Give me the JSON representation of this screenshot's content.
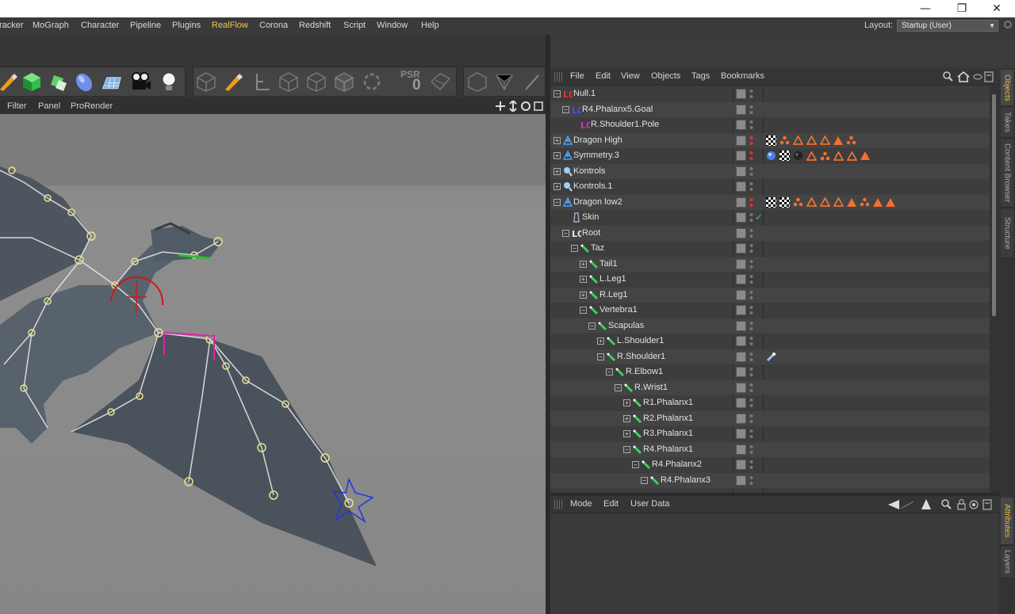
{
  "window": {
    "minimize": "—",
    "restore": "❐",
    "close": "✕"
  },
  "menubar": {
    "items": [
      "racker",
      "MoGraph",
      "Character",
      "Pipeline",
      "Plugins",
      "RealFlow",
      "Corona",
      "Redshift",
      "Script",
      "Window",
      "Help"
    ],
    "active": "RealFlow",
    "layout_label": "Layout:",
    "layout_value": "Startup (User)"
  },
  "toolbar": {
    "psr_label": "PSR",
    "psr_value": "0"
  },
  "viewport": {
    "menu": [
      "Filter",
      "Panel",
      "ProRender"
    ]
  },
  "object_manager": {
    "menu": [
      "File",
      "Edit",
      "View",
      "Objects",
      "Tags",
      "Bookmarks"
    ],
    "objects": [
      {
        "name": "Null.1",
        "indent": 0,
        "type": "null",
        "expand": "minus"
      },
      {
        "name": "R4.Phalanx5.Goal",
        "indent": 1,
        "type": "goal",
        "expand": "minus"
      },
      {
        "name": "R.Shoulder1.Pole",
        "indent": 2,
        "type": "pole",
        "expand": "none"
      },
      {
        "name": "Dragon High",
        "indent": 0,
        "type": "mesh",
        "expand": "plus"
      },
      {
        "name": "Symmetry.3",
        "indent": 0,
        "type": "mesh",
        "expand": "plus"
      },
      {
        "name": "Kontrols",
        "indent": 0,
        "type": "ctrl",
        "expand": "plus"
      },
      {
        "name": "Kontrols.1",
        "indent": 0,
        "type": "ctrl",
        "expand": "plus"
      },
      {
        "name": "Dragon low2",
        "indent": 0,
        "type": "mesh",
        "expand": "minus"
      },
      {
        "name": "Skin",
        "indent": 1,
        "type": "skin",
        "expand": "none"
      },
      {
        "name": "Root",
        "indent": 1,
        "type": "root",
        "expand": "minus"
      },
      {
        "name": "Taz",
        "indent": 2,
        "type": "joint",
        "expand": "minus"
      },
      {
        "name": "Tail1",
        "indent": 3,
        "type": "joint",
        "expand": "plus"
      },
      {
        "name": "L.Leg1",
        "indent": 3,
        "type": "joint",
        "expand": "plus"
      },
      {
        "name": "R.Leg1",
        "indent": 3,
        "type": "joint",
        "expand": "plus"
      },
      {
        "name": "Vertebra1",
        "indent": 3,
        "type": "joint",
        "expand": "minus"
      },
      {
        "name": "Scapulas",
        "indent": 4,
        "type": "joint",
        "expand": "minus"
      },
      {
        "name": "L.Shoulder1",
        "indent": 5,
        "type": "joint",
        "expand": "plus"
      },
      {
        "name": "R.Shoulder1",
        "indent": 5,
        "type": "joint",
        "expand": "minus"
      },
      {
        "name": "R.Elbow1",
        "indent": 6,
        "type": "joint",
        "expand": "minus"
      },
      {
        "name": "R.Wrist1",
        "indent": 7,
        "type": "joint",
        "expand": "minus"
      },
      {
        "name": "R1.Phalanx1",
        "indent": 8,
        "type": "joint",
        "expand": "plus"
      },
      {
        "name": "R2.Phalanx1",
        "indent": 8,
        "type": "joint",
        "expand": "plus"
      },
      {
        "name": "R3.Phalanx1",
        "indent": 8,
        "type": "joint",
        "expand": "plus"
      },
      {
        "name": "R4.Phalanx1",
        "indent": 8,
        "type": "joint",
        "expand": "minus"
      },
      {
        "name": "R4.Phalanx2",
        "indent": 9,
        "type": "joint",
        "expand": "minus"
      },
      {
        "name": "R4.Phalanx3",
        "indent": 10,
        "type": "joint",
        "expand": "minus"
      }
    ]
  },
  "attribute_manager": {
    "menu": [
      "Mode",
      "Edit",
      "User Data"
    ]
  },
  "side_tabs": {
    "top": [
      "Objects",
      "Takes",
      "Content Browser",
      "Structure"
    ],
    "bottom": [
      "Attributes",
      "Layers"
    ]
  }
}
